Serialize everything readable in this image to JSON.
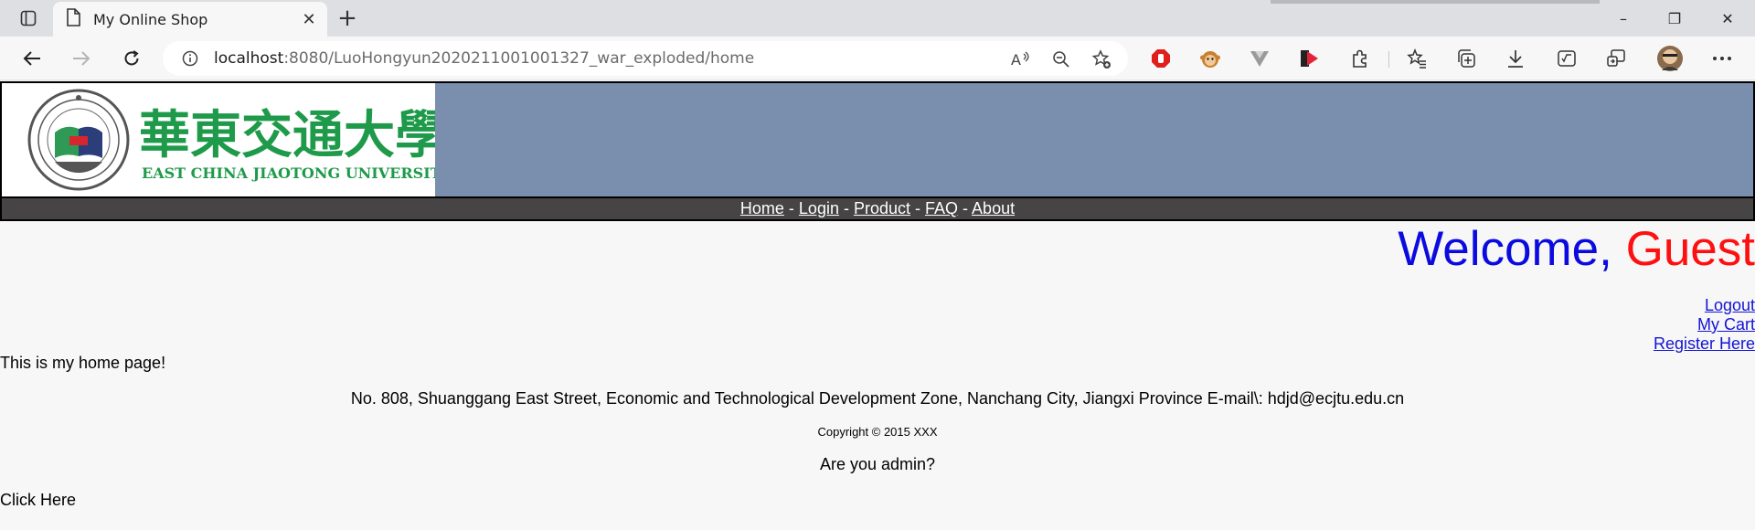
{
  "browser": {
    "tab_title": "My Online Shop",
    "tab_close": "✕",
    "new_tab": "+",
    "url_host": "localhost",
    "url_rest": ":8080/LuoHongyun2020211001001327_war_exploded/home",
    "window_controls": {
      "minimize": "–",
      "restore": "❐",
      "close": "✕"
    }
  },
  "logo": {
    "chinese_name": "華東交通大學",
    "english_name": "EAST CHINA JIAOTONG UNIVERSITY",
    "seal_text": "EAST CHINA JIAOTONG UNIVERSITY",
    "seal_mark": "ECJTU",
    "brand_green": "#1e9a4a"
  },
  "nav": {
    "items": [
      {
        "label": "Home"
      },
      {
        "label": "Login"
      },
      {
        "label": "Product"
      },
      {
        "label": "FAQ"
      },
      {
        "label": "About"
      }
    ],
    "separator": " - "
  },
  "welcome": {
    "prefix": "Welcome, ",
    "name": "Guest"
  },
  "side_links": {
    "logout": "Logout",
    "cart": "My Cart",
    "register": "Register Here"
  },
  "main": {
    "home_text": "This is my home page!",
    "address": "No. 808, Shuanggang East Street, Economic and Technological Development Zone, Nanchang City, Jiangxi Province E-mail\\: hdjd@ecjtu.edu.cn",
    "copyright": "Copyright © 2015 XXX",
    "admin_question": "Are you admin?",
    "click_here": "Click Here"
  },
  "colors": {
    "header_bg": "#7a8eae",
    "nav_bg": "#464444",
    "welcome_blue": "#0b0be0",
    "welcome_red": "#ff1010",
    "link": "#1414d6"
  }
}
